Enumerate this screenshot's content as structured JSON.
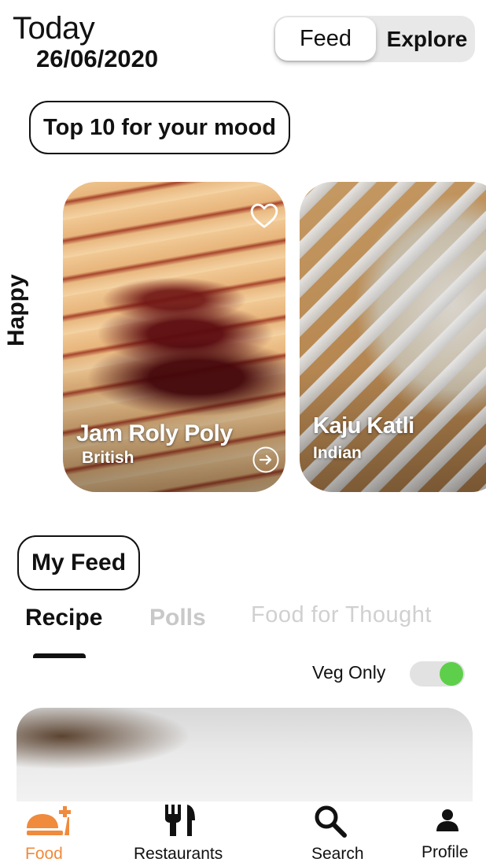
{
  "header": {
    "title": "Today",
    "date": "26/06/2020",
    "segmented": {
      "active": "Feed",
      "inactive": "Explore"
    }
  },
  "top10": {
    "label": "Top 10 for your mood",
    "mood": "Happy",
    "cards": [
      {
        "title": "Jam Roly Poly",
        "subtitle": "British"
      },
      {
        "title": "Kaju Katli",
        "subtitle": "Indian"
      }
    ]
  },
  "my_feed": {
    "label": "My Feed",
    "tabs": [
      {
        "label": "Recipe",
        "selected": true
      },
      {
        "label": "Polls",
        "selected": false
      },
      {
        "label": "Food for Thought",
        "selected": false
      }
    ],
    "veg_only": {
      "label": "Veg Only",
      "on": true
    }
  },
  "bottom_nav": {
    "items": [
      {
        "label": "Food",
        "icon": "food-cloche-icon",
        "active": true
      },
      {
        "label": "Restaurants",
        "icon": "fork-knife-icon",
        "active": false
      },
      {
        "label": "Search",
        "icon": "search-icon",
        "active": false
      },
      {
        "label": "Profile",
        "icon": "profile-icon",
        "active": false
      }
    ]
  },
  "colors": {
    "accent": "#f08a3c",
    "toggle_on": "#5ecf4a",
    "inactive_tab": "#c8c8c8"
  }
}
